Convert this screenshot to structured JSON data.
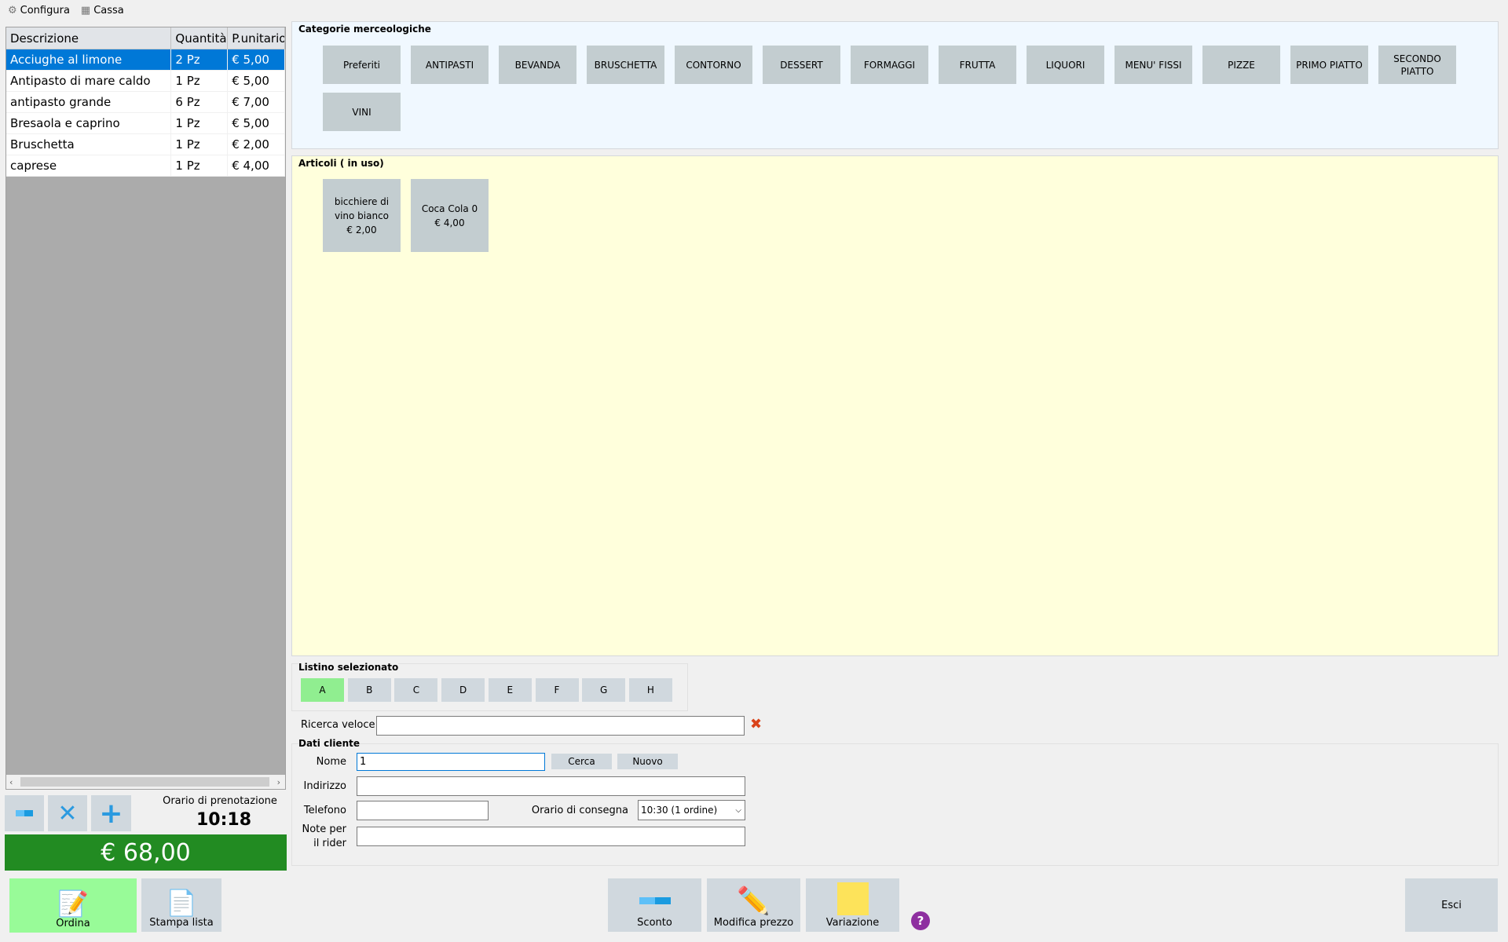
{
  "menu": {
    "configura": "Configura",
    "cassa": "Cassa"
  },
  "table": {
    "headers": [
      "Descrizione",
      "Quantità",
      "P.unitario"
    ],
    "rows": [
      [
        "Acciughe al limone",
        "2 Pz",
        "€ 5,00"
      ],
      [
        "Antipasto di mare caldo",
        "1 Pz",
        "€ 5,00"
      ],
      [
        "antipasto grande",
        "6 Pz",
        "€ 7,00"
      ],
      [
        "Bresaola e caprino",
        "1 Pz",
        "€ 5,00"
      ],
      [
        "Bruschetta",
        "1 Pz",
        "€ 2,00"
      ],
      [
        "caprese",
        "1 Pz",
        "€ 4,00"
      ]
    ],
    "selected_row": 0
  },
  "booking": {
    "label": "Orario di prenotazione",
    "time": "10:18"
  },
  "total": "€ 68,00",
  "actions": {
    "ordina": "Ordina",
    "stampa": "Stampa lista",
    "sconto": "Sconto",
    "modifica": "Modifica prezzo",
    "variazione": "Variazione",
    "esci": "Esci"
  },
  "categories": {
    "title": "Categorie merceologiche",
    "items": [
      "Preferiti",
      "ANTIPASTI",
      "BEVANDA",
      "BRUSCHETTA",
      "CONTORNO",
      "DESSERT",
      "FORMAGGI",
      "FRUTTA",
      "LIQUORI",
      "MENU' FISSI",
      "PIZZE",
      "PRIMO PIATTO",
      "SECONDO PIATTO",
      "VINI"
    ]
  },
  "articles": {
    "title": "Articoli ( in uso)",
    "items": [
      {
        "name": "bicchiere di vino bianco",
        "price": "€ 2,00"
      },
      {
        "name": "Coca Cola 0",
        "price": "€ 4,00"
      }
    ]
  },
  "listino": {
    "title": "Listino selezionato",
    "items": [
      "A",
      "B",
      "C",
      "D",
      "E",
      "F",
      "G",
      "H"
    ],
    "selected": "A"
  },
  "search": {
    "label": "Ricerca veloce",
    "value": ""
  },
  "customer": {
    "title": "Dati cliente",
    "nome_label": "Nome",
    "nome_value": "1",
    "cerca": "Cerca",
    "nuovo": "Nuovo",
    "indirizzo_label": "Indirizzo",
    "telefono_label": "Telefono",
    "consegna_label": "Orario di consegna",
    "consegna_value": "10:30 (1 ordine)",
    "note_label_1": "Note per",
    "note_label_2": "il rider"
  },
  "colors": {
    "selection": "#0078d7",
    "total_bg": "#228b22",
    "active_green": "#98fb98",
    "category_bg": "#f0f8ff",
    "articles_bg": "#ffffdc"
  }
}
